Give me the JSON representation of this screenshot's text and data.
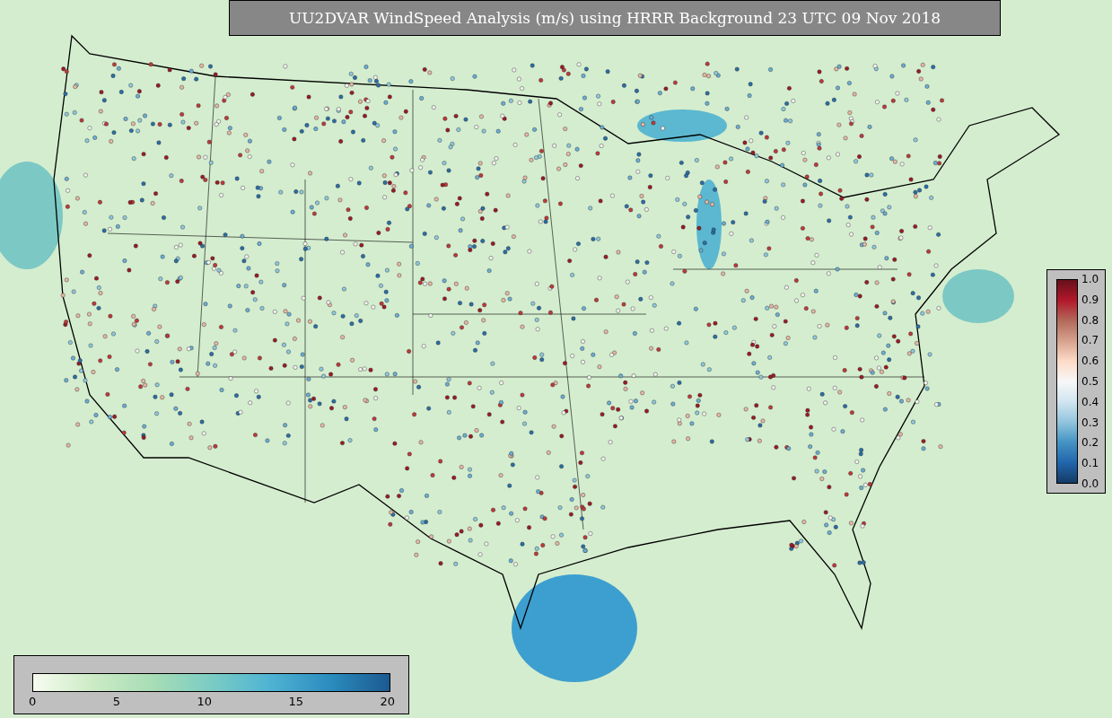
{
  "title": "UU2DVAR WindSpeed Analysis (m/s) using HRRR Background 23 UTC 09 Nov 2018",
  "ratio_colorbar": {
    "ticks": [
      "1.0",
      "0.9",
      "0.8",
      "0.7",
      "0.6",
      "0.5",
      "0.4",
      "0.3",
      "0.2",
      "0.1",
      "0.0"
    ]
  },
  "speed_colorbar": {
    "ticks": [
      "0",
      "5",
      "10",
      "15",
      "20"
    ]
  }
}
